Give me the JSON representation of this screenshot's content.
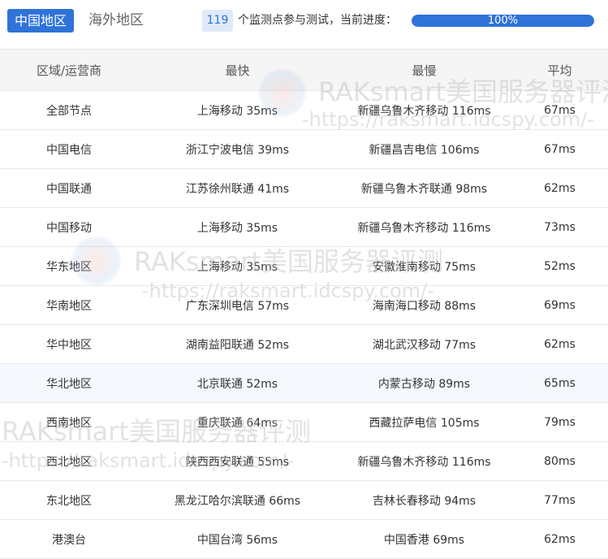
{
  "tabs": {
    "active": "中国地区",
    "inactive": "海外地区"
  },
  "status": {
    "count": "119",
    "count_text": "个监测点参与测试，当前进度：",
    "progress_label": "100%",
    "progress_value": 1.0
  },
  "table": {
    "headers": [
      "区域/运营商",
      "最快",
      "最慢",
      "平均"
    ],
    "rows": [
      [
        "全部节点",
        "上海移动 35ms",
        "新疆乌鲁木齐移动 116ms",
        "67ms"
      ],
      [
        "中国电信",
        "浙江宁波电信 39ms",
        "新疆昌吉电信 106ms",
        "67ms"
      ],
      [
        "中国联通",
        "江苏徐州联通 41ms",
        "新疆乌鲁木齐联通 98ms",
        "62ms"
      ],
      [
        "中国移动",
        "上海移动 35ms",
        "新疆乌鲁木齐移动 116ms",
        "73ms"
      ],
      [
        "华东地区",
        "上海移动 35ms",
        "安徽淮南移动 75ms",
        "52ms"
      ],
      [
        "华南地区",
        "广东深圳电信 57ms",
        "海南海口移动 88ms",
        "69ms"
      ],
      [
        "华中地区",
        "湖南益阳联通 52ms",
        "湖北武汉移动 77ms",
        "62ms"
      ],
      [
        "华北地区",
        "北京联通 52ms",
        "内蒙古移动 89ms",
        "65ms"
      ],
      [
        "西南地区",
        "重庆联通 64ms",
        "西藏拉萨电信 105ms",
        "79ms"
      ],
      [
        "西北地区",
        "陕西西安联通 55ms",
        "新疆乌鲁木齐移动 116ms",
        "80ms"
      ],
      [
        "东北地区",
        "黑龙江哈尔滨联通 66ms",
        "吉林长春移动 94ms",
        "77ms"
      ],
      [
        "港澳台",
        "中国台湾 56ms",
        "中国香港 69ms",
        "62ms"
      ]
    ],
    "highlighted_row": 7
  },
  "watermark": {
    "title": "RAKsmart美国服务器评测",
    "url": "-https://raksmart.idcspy.com/-"
  },
  "colors": {
    "accent": "#2f73d9",
    "badge_bg": "#dfeaf9",
    "header_bg": "#f5f5f5"
  }
}
